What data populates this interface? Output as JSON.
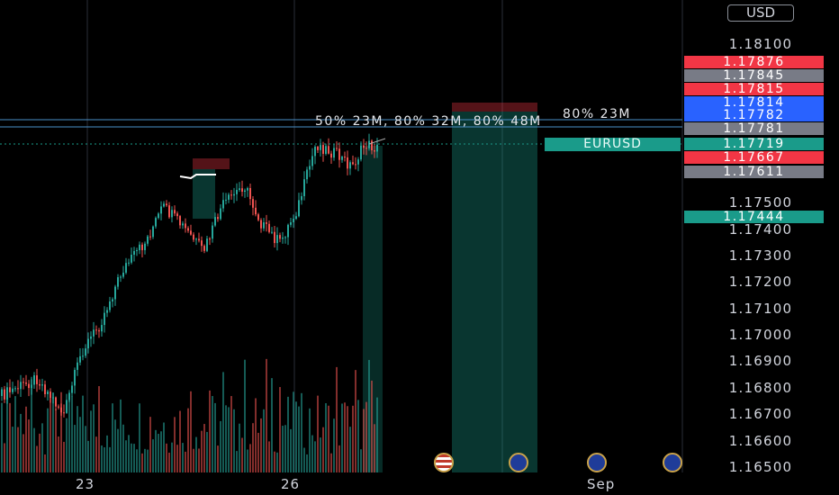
{
  "currency": "USD",
  "symbol": "EURUSD",
  "annotations": {
    "order_line_1": "80% 23M",
    "order_line_2": "50% 23M, 80% 32M, 80% 48M"
  },
  "price_axis": [
    "1.18100",
    "1.17500",
    "1.17400",
    "1.17300",
    "1.17200",
    "1.17100",
    "1.17000",
    "1.16900",
    "1.16800",
    "1.16700",
    "1.16600",
    "1.16500"
  ],
  "time_axis": [
    "23",
    "26",
    "Sep"
  ],
  "price_badges": [
    {
      "value": "1.17876",
      "color": "#f23645"
    },
    {
      "value": "1.17845",
      "color": "#787b86"
    },
    {
      "value": "1.17815",
      "color": "#f23645"
    },
    {
      "value": "1.17814",
      "color": "#2962ff"
    },
    {
      "value": "1.17782",
      "color": "#2962ff"
    },
    {
      "value": "1.17781",
      "color": "#787b86"
    },
    {
      "value": "1.17719",
      "color": "#1a9b8a"
    },
    {
      "value": "1.17667",
      "color": "#f23645"
    },
    {
      "value": "1.17611",
      "color": "#787b86"
    },
    {
      "value": "1.17444",
      "color": "#1a9b8a"
    }
  ],
  "events": [
    "us-flag-icon",
    "eu-flag-icon",
    "eu-flag-icon",
    "eu-flag-icon"
  ],
  "colors": {
    "up": "#26a69a",
    "down": "#ef5350",
    "grid": "#2a2e39"
  }
}
